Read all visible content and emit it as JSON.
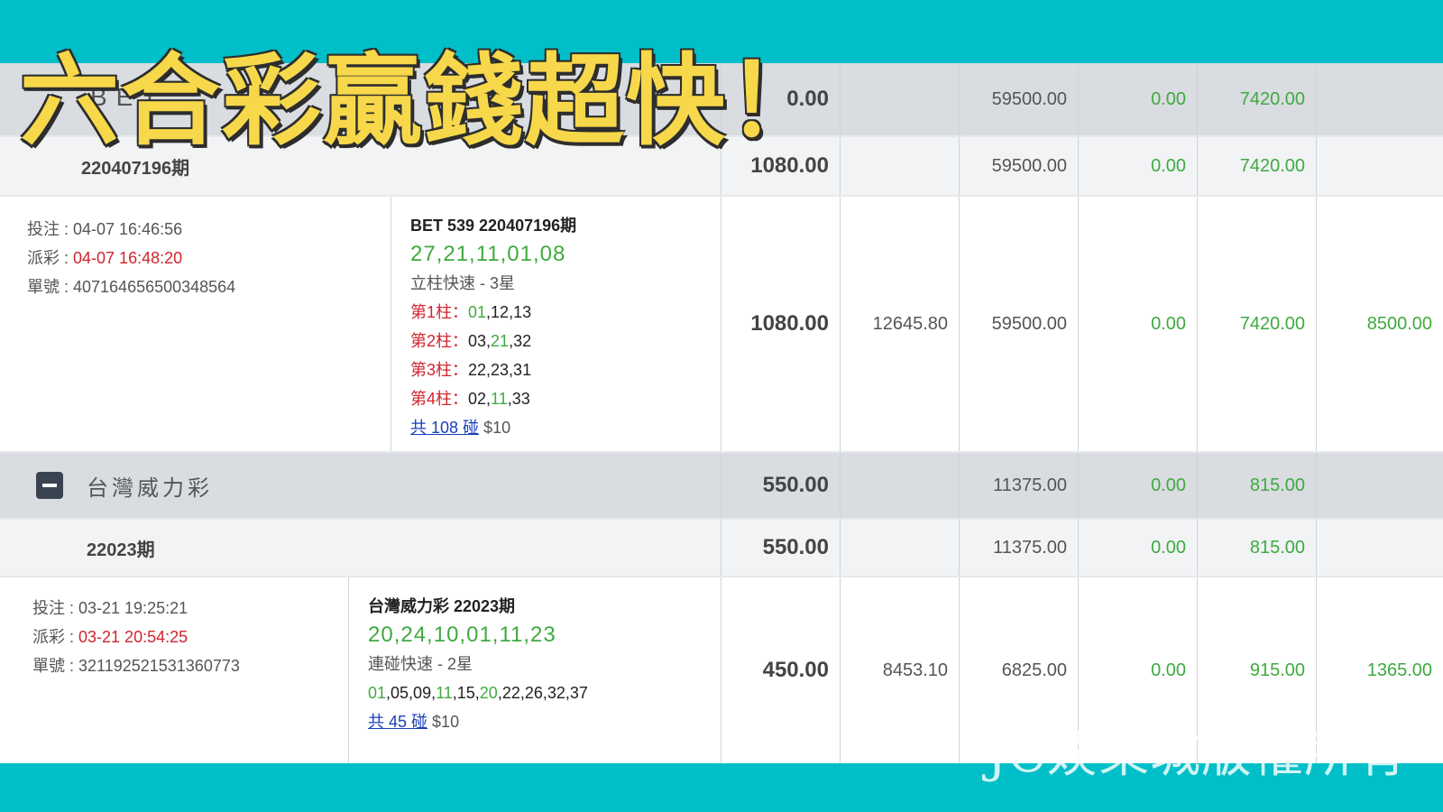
{
  "banner": {
    "title": "六合彩贏錢超快！",
    "watermark": "JC娛樂城版權所有"
  },
  "summary_row": {
    "label_partial": "BET",
    "amount_partial": "0.00",
    "col_b": "59500.00",
    "col_c": "0.00",
    "col_d": "7420.00"
  },
  "period_row_1": {
    "label": "220407196期",
    "amount": "1080.00",
    "col_b": "59500.00",
    "col_c": "0.00",
    "col_d": "7420.00"
  },
  "detail_row_1": {
    "bet_time": "投注 : 04-07 16:46:56",
    "draw_label": "派彩 : ",
    "draw_time": "04-07 16:48:20",
    "order_no": "單號 : 407164656500348564",
    "bet_title": "BET 539 220407196期",
    "draw_numbers": "27,21,11,01,08",
    "play_type": "立柱快速 - 3星",
    "columns": [
      {
        "label": "第1柱：",
        "nums": [
          {
            "v": "01",
            "hit": true
          },
          {
            "v": ",12,13",
            "hit": false
          }
        ]
      },
      {
        "label": "第2柱：",
        "nums": [
          {
            "v": "03,",
            "hit": false
          },
          {
            "v": "21",
            "hit": true
          },
          {
            "v": ",32",
            "hit": false
          }
        ]
      },
      {
        "label": "第3柱：",
        "nums": [
          {
            "v": "22,23,31",
            "hit": false
          }
        ]
      },
      {
        "label": "第4柱：",
        "nums": [
          {
            "v": "02,",
            "hit": false
          },
          {
            "v": "11",
            "hit": true
          },
          {
            "v": ",33",
            "hit": false
          }
        ]
      }
    ],
    "combo_link": "共 108 碰",
    "unit": "$10",
    "amount": "1080.00",
    "col_a": "12645.80",
    "col_b": "59500.00",
    "col_c": "0.00",
    "col_d": "7420.00",
    "col_e": "8500.00"
  },
  "group_row": {
    "label": "台灣威力彩",
    "amount": "550.00",
    "col_b": "11375.00",
    "col_c": "0.00",
    "col_d": "815.00"
  },
  "period_row_2": {
    "label": "22023期",
    "amount": "550.00",
    "col_b": "11375.00",
    "col_c": "0.00",
    "col_d": "815.00"
  },
  "detail_row_2": {
    "bet_time": "投注 : 03-21 19:25:21",
    "draw_label": "派彩 : ",
    "draw_time": "03-21 20:54:25",
    "order_no": "單號 : 321192521531360773",
    "bet_title": "台灣威力彩 22023期",
    "draw_numbers": "20,24,10,01,11,23",
    "play_type": "連碰快速 - 2星",
    "nums": [
      {
        "v": "01",
        "hit": true
      },
      {
        "v": ",05,09,",
        "hit": false
      },
      {
        "v": "11",
        "hit": true
      },
      {
        "v": ",15,",
        "hit": false
      },
      {
        "v": "20",
        "hit": true
      },
      {
        "v": ",22,26,32,37",
        "hit": false
      }
    ],
    "combo_link": "共 45 碰",
    "unit": "$10",
    "amount": "450.00",
    "col_a": "8453.10",
    "col_b": "6825.00",
    "col_c": "0.00",
    "col_d": "915.00",
    "col_e": "1365.00"
  },
  "colors": {
    "background": "#00bfc8",
    "win_green": "#3faa3f",
    "draw_red": "#d0252d",
    "link_blue": "#1a3fb8",
    "title_yellow": "#f7d84a"
  }
}
